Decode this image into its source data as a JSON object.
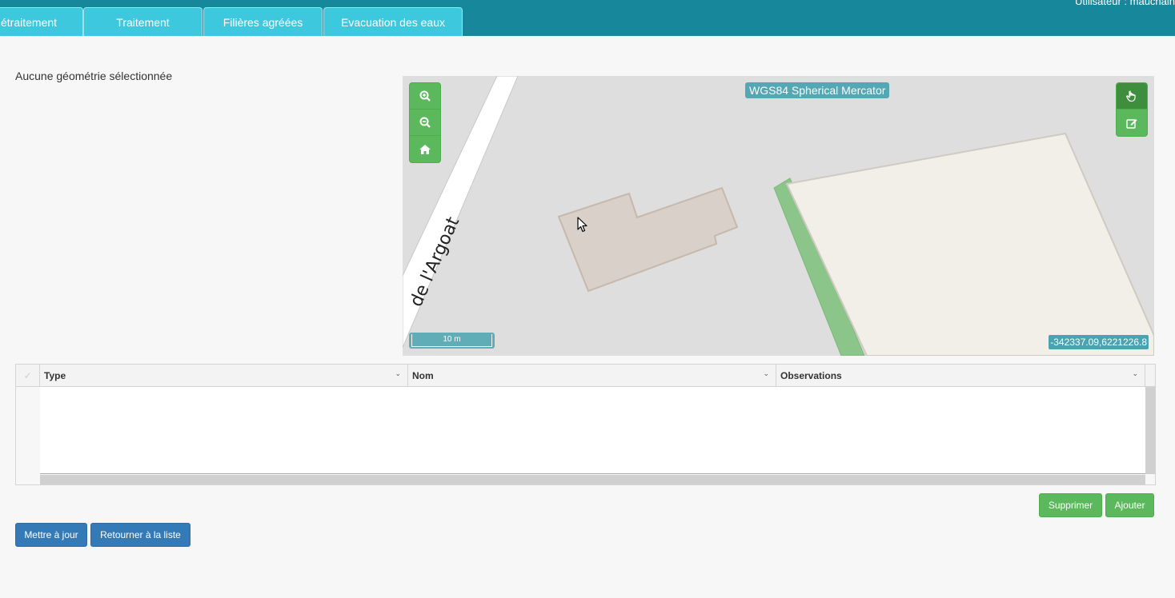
{
  "header": {
    "user_label": "Utilisateur : mauchain",
    "tabs": [
      {
        "label": "étraitement"
      },
      {
        "label": "Traitement"
      },
      {
        "label": "Filières agréées"
      },
      {
        "label": "Evacuation des eaux"
      }
    ]
  },
  "geometry": {
    "none_selected": "Aucune géométrie sélectionnée"
  },
  "map": {
    "projection": "WGS84 Spherical Mercator",
    "scale_label": "10 m",
    "coordinates": "-342337.09,6221226.8",
    "street_label": "de l'Argoat",
    "controls_left": [
      "zoom-in-icon",
      "zoom-out-icon",
      "home-icon"
    ],
    "controls_right": [
      "pointer-hand-icon",
      "edit-icon"
    ],
    "colors": {
      "background": "#dedede",
      "building": "#d9d0c9",
      "parcel": "#f2efe9",
      "green_path": "#8cc58a",
      "controls": "#5cb85c"
    }
  },
  "grid": {
    "columns": [
      "Type",
      "Nom",
      "Observations"
    ],
    "rows": []
  },
  "actions": {
    "delete": "Supprimer",
    "add": "Ajouter",
    "update": "Mettre à jour",
    "back": "Retourner à la liste"
  }
}
